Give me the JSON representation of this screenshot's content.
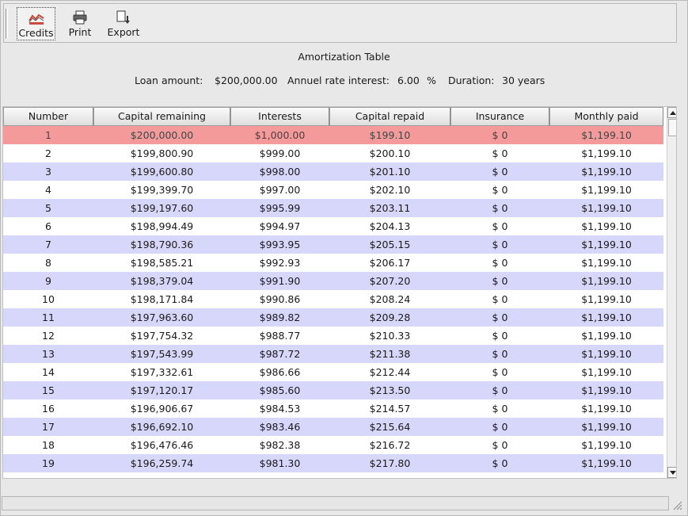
{
  "toolbar": {
    "buttons": [
      {
        "label": "Credits",
        "icon": "credits-chart-icon"
      },
      {
        "label": "Print",
        "icon": "printer-icon"
      },
      {
        "label": "Export",
        "icon": "export-icon"
      }
    ]
  },
  "title": "Amortization Table",
  "params": {
    "loan_label": "Loan amount:",
    "loan_value": "$200,000.00",
    "rate_label": "Annuel rate interest:",
    "rate_value": "6.00",
    "rate_unit": "%",
    "duration_label": "Duration:",
    "duration_value": "30 years"
  },
  "table": {
    "columns": [
      "Number",
      "Capital remaining",
      "Interests",
      "Capital repaid",
      "Insurance",
      "Monthly paid"
    ],
    "rows": [
      [
        "1",
        "$200,000.00",
        "$1,000.00",
        "$199.10",
        "$ 0",
        "$1,199.10"
      ],
      [
        "2",
        "$199,800.90",
        "$999.00",
        "$200.10",
        "$ 0",
        "$1,199.10"
      ],
      [
        "3",
        "$199,600.80",
        "$998.00",
        "$201.10",
        "$ 0",
        "$1,199.10"
      ],
      [
        "4",
        "$199,399.70",
        "$997.00",
        "$202.10",
        "$ 0",
        "$1,199.10"
      ],
      [
        "5",
        "$199,197.60",
        "$995.99",
        "$203.11",
        "$ 0",
        "$1,199.10"
      ],
      [
        "6",
        "$198,994.49",
        "$994.97",
        "$204.13",
        "$ 0",
        "$1,199.10"
      ],
      [
        "7",
        "$198,790.36",
        "$993.95",
        "$205.15",
        "$ 0",
        "$1,199.10"
      ],
      [
        "8",
        "$198,585.21",
        "$992.93",
        "$206.17",
        "$ 0",
        "$1,199.10"
      ],
      [
        "9",
        "$198,379.04",
        "$991.90",
        "$207.20",
        "$ 0",
        "$1,199.10"
      ],
      [
        "10",
        "$198,171.84",
        "$990.86",
        "$208.24",
        "$ 0",
        "$1,199.10"
      ],
      [
        "11",
        "$197,963.60",
        "$989.82",
        "$209.28",
        "$ 0",
        "$1,199.10"
      ],
      [
        "12",
        "$197,754.32",
        "$988.77",
        "$210.33",
        "$ 0",
        "$1,199.10"
      ],
      [
        "13",
        "$197,543.99",
        "$987.72",
        "$211.38",
        "$ 0",
        "$1,199.10"
      ],
      [
        "14",
        "$197,332.61",
        "$986.66",
        "$212.44",
        "$ 0",
        "$1,199.10"
      ],
      [
        "15",
        "$197,120.17",
        "$985.60",
        "$213.50",
        "$ 0",
        "$1,199.10"
      ],
      [
        "16",
        "$196,906.67",
        "$984.53",
        "$214.57",
        "$ 0",
        "$1,199.10"
      ],
      [
        "17",
        "$196,692.10",
        "$983.46",
        "$215.64",
        "$ 0",
        "$1,199.10"
      ],
      [
        "18",
        "$196,476.46",
        "$982.38",
        "$216.72",
        "$ 0",
        "$1,199.10"
      ],
      [
        "19",
        "$196,259.74",
        "$981.30",
        "$217.80",
        "$ 0",
        "$1,199.10"
      ]
    ],
    "selected_row": 0
  },
  "colors": {
    "selected_row": "#f49a9a",
    "alt_row": "#d7d7fb",
    "row": "#ffffff"
  }
}
